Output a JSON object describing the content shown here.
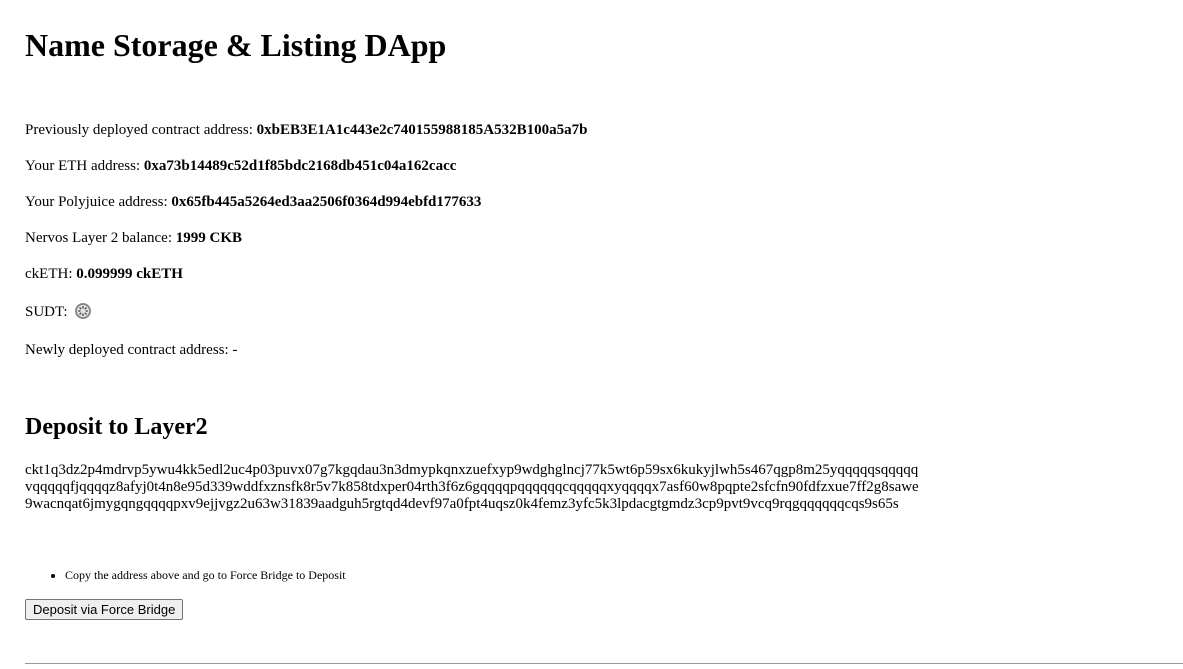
{
  "title": "Name Storage & Listing DApp",
  "info": {
    "previous_contract_label": "Previously deployed contract address: ",
    "previous_contract_value": "0xbEB3E1A1c443e2c740155988185A532B100a5a7b",
    "eth_address_label": "Your ETH address: ",
    "eth_address_value": "0xa73b14489c52d1f85bdc2168db451c04a162cacc",
    "polyjuice_label": "Your Polyjuice address: ",
    "polyjuice_value": "0x65fb445a5264ed3aa2506f0364d994ebfd177633",
    "balance_label": "Nervos Layer 2 balance: ",
    "balance_value": "1999 CKB",
    "cketh_label": "ckETH: ",
    "cketh_value": "0.099999 ckETH",
    "sudt_label": "SUDT: ",
    "sudt_status_icon": "loading-spinner-icon",
    "new_contract_label": "Newly deployed contract address: ",
    "new_contract_value": "-"
  },
  "deposit": {
    "section_title": "Deposit to Layer2",
    "address_lines": [
      "ckt1q3dz2p4mdrvp5ywu4kk5edl2uc4p03puvx07g7kgqdau3n3dmypkqnxzuefxyp9wdghglncj77k5wt6p59sx6kukyjlwh5s467qgp8m25yqqqqqsqqqqq",
      "vqqqqqfjqqqqz8afyj0t4n8e95d339wddfxznsfk8r5v7k858tdxper04rth3f6z6gqqqqpqqqqqqcqqqqqxyqqqqx7asf60w8pqpte2sfcfn90fdfzxue7ff2g8sawe",
      "9wacnqat6jmygqngqqqqpxv9ejjvgz2u63w31839aadguh5rgtqd4devf97a0fpt4uqsz0k4femz3yfc5k3lpdacgtgmdz3cp9pvt9vcq9rqgqqqqqqcqs9s65s"
    ],
    "hint": "Copy the address above and go to Force Bridge to Deposit",
    "button_label": "Deposit via Force Bridge"
  }
}
